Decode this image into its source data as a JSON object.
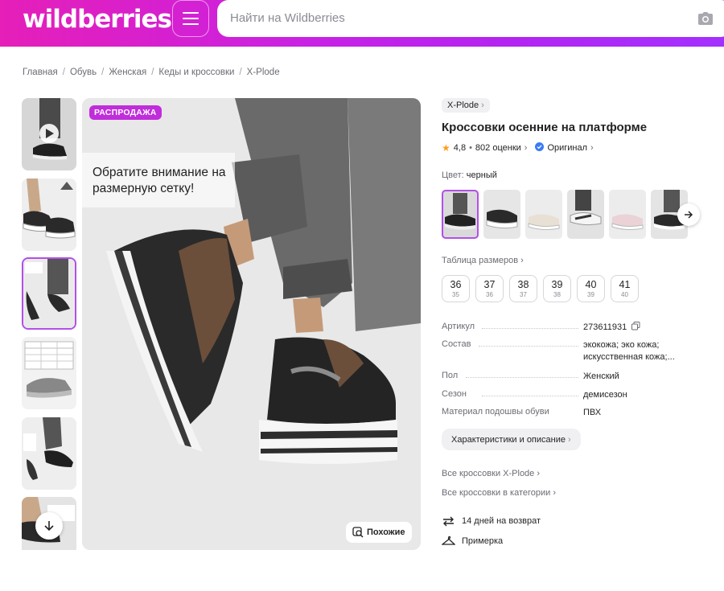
{
  "header": {
    "logo": "wildberries",
    "search_placeholder": "Найти на Wildberries",
    "menu_icon": "hamburger-icon",
    "camera_icon": "camera-icon",
    "gradient_colors": [
      "#e51fb8",
      "#c722e6",
      "#a430ff"
    ]
  },
  "breadcrumb": [
    "Главная",
    "Обувь",
    "Женская",
    "Кеды и кроссовки",
    "X-Plode"
  ],
  "gallery": {
    "badge": "РАСПРОДАЖА",
    "hint": "Обратите внимание на размерную сетку!",
    "similar_label": "Похожие",
    "thumb_count": 6,
    "active_thumb": 3
  },
  "product": {
    "brand": "X-Plode",
    "title": "Кроссовки осенние на платформе",
    "rating": "4,8",
    "reviews": "802 оценки",
    "original_label": "Оригинал",
    "color_label": "Цвет:",
    "color_value": "черный",
    "size_table_label": "Таблица размеров",
    "sizes": [
      {
        "size": "36",
        "ru": "35"
      },
      {
        "size": "37",
        "ru": "36"
      },
      {
        "size": "38",
        "ru": "37"
      },
      {
        "size": "39",
        "ru": "38"
      },
      {
        "size": "40",
        "ru": "39"
      },
      {
        "size": "41",
        "ru": "40"
      }
    ],
    "specs": [
      {
        "key": "Артикул",
        "value": "273611931"
      },
      {
        "key": "Состав",
        "value": "экокожа; эко кожа; искусственная кожа;..."
      },
      {
        "key": "Пол",
        "value": "Женский"
      },
      {
        "key": "Сезон",
        "value": "демисезон"
      },
      {
        "key": "Материал подошвы обуви",
        "value": "ПВХ"
      }
    ],
    "chars_button": "Характеристики и описание",
    "links": [
      "Все кроссовки X-Plode",
      "Все кроссовки в категории"
    ],
    "perks": [
      {
        "icon": "return-arrows-icon",
        "label": "14 дней на возврат"
      },
      {
        "icon": "hanger-icon",
        "label": "Примерка"
      }
    ],
    "accent_color": "#b34fe6",
    "star_color": "#ff9d1a",
    "badge_color": "#c02ddb"
  }
}
